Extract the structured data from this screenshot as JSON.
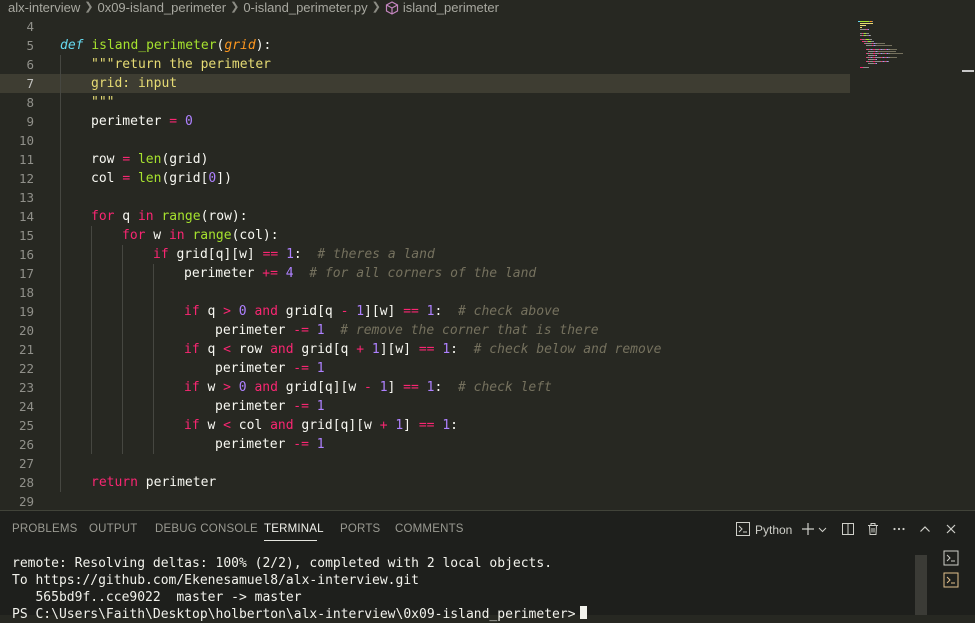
{
  "breadcrumb": {
    "items": [
      "alx-interview",
      "0x09-island_perimeter",
      "0-island_perimeter.py",
      "island_perimeter"
    ],
    "separator": ">"
  },
  "editor": {
    "active_line": 7,
    "lines": [
      {
        "n": "4",
        "indent": 0,
        "t": []
      },
      {
        "n": "5",
        "indent": 0,
        "t": [
          [
            "d",
            "def "
          ],
          [
            "f",
            "island_perimeter"
          ],
          [
            "w",
            "("
          ],
          [
            "p",
            "grid"
          ],
          [
            "w",
            "):"
          ]
        ]
      },
      {
        "n": "6",
        "indent": 1,
        "t": [
          [
            "s",
            "\"\"\"return the perimeter"
          ]
        ]
      },
      {
        "n": "7",
        "indent": 1,
        "t": [
          [
            "s",
            "grid: input"
          ]
        ]
      },
      {
        "n": "8",
        "indent": 1,
        "t": [
          [
            "s",
            "\"\"\""
          ]
        ]
      },
      {
        "n": "9",
        "indent": 1,
        "t": [
          [
            "w",
            "perimeter "
          ],
          [
            "k",
            "="
          ],
          [
            "w",
            " "
          ],
          [
            "n",
            "0"
          ]
        ]
      },
      {
        "n": "10",
        "indent": 0,
        "t": []
      },
      {
        "n": "11",
        "indent": 1,
        "t": [
          [
            "w",
            "row "
          ],
          [
            "k",
            "="
          ],
          [
            "w",
            " "
          ],
          [
            "f",
            "len"
          ],
          [
            "w",
            "(grid)"
          ]
        ]
      },
      {
        "n": "12",
        "indent": 1,
        "t": [
          [
            "w",
            "col "
          ],
          [
            "k",
            "="
          ],
          [
            "w",
            " "
          ],
          [
            "f",
            "len"
          ],
          [
            "w",
            "(grid["
          ],
          [
            "n",
            "0"
          ],
          [
            "w",
            "])"
          ]
        ]
      },
      {
        "n": "13",
        "indent": 0,
        "t": []
      },
      {
        "n": "14",
        "indent": 1,
        "t": [
          [
            "k",
            "for"
          ],
          [
            "w",
            " q "
          ],
          [
            "k",
            "in"
          ],
          [
            "w",
            " "
          ],
          [
            "f",
            "range"
          ],
          [
            "w",
            "(row):"
          ]
        ]
      },
      {
        "n": "15",
        "indent": 2,
        "t": [
          [
            "k",
            "for"
          ],
          [
            "w",
            " w "
          ],
          [
            "k",
            "in"
          ],
          [
            "w",
            " "
          ],
          [
            "f",
            "range"
          ],
          [
            "w",
            "(col):"
          ]
        ]
      },
      {
        "n": "16",
        "indent": 3,
        "t": [
          [
            "k",
            "if"
          ],
          [
            "w",
            " grid[q][w] "
          ],
          [
            "k",
            "=="
          ],
          [
            "w",
            " "
          ],
          [
            "n",
            "1"
          ],
          [
            "w",
            ":  "
          ],
          [
            "c",
            "# theres a land"
          ]
        ]
      },
      {
        "n": "17",
        "indent": 4,
        "t": [
          [
            "w",
            "perimeter "
          ],
          [
            "k",
            "+="
          ],
          [
            "w",
            " "
          ],
          [
            "n",
            "4"
          ],
          [
            "w",
            "  "
          ],
          [
            "c",
            "# for all corners of the land"
          ]
        ]
      },
      {
        "n": "18",
        "indent": 0,
        "t": []
      },
      {
        "n": "19",
        "indent": 4,
        "t": [
          [
            "k",
            "if"
          ],
          [
            "w",
            " q "
          ],
          [
            "k",
            ">"
          ],
          [
            "w",
            " "
          ],
          [
            "n",
            "0"
          ],
          [
            "w",
            " "
          ],
          [
            "k",
            "and"
          ],
          [
            "w",
            " grid[q "
          ],
          [
            "k",
            "-"
          ],
          [
            "w",
            " "
          ],
          [
            "n",
            "1"
          ],
          [
            "w",
            "][w] "
          ],
          [
            "k",
            "=="
          ],
          [
            "w",
            " "
          ],
          [
            "n",
            "1"
          ],
          [
            "w",
            ":  "
          ],
          [
            "c",
            "# check above"
          ]
        ]
      },
      {
        "n": "20",
        "indent": 5,
        "t": [
          [
            "w",
            "perimeter "
          ],
          [
            "k",
            "-="
          ],
          [
            "w",
            " "
          ],
          [
            "n",
            "1"
          ],
          [
            "w",
            "  "
          ],
          [
            "c",
            "# remove the corner that is there"
          ]
        ]
      },
      {
        "n": "21",
        "indent": 4,
        "t": [
          [
            "k",
            "if"
          ],
          [
            "w",
            " q "
          ],
          [
            "k",
            "<"
          ],
          [
            "w",
            " row "
          ],
          [
            "k",
            "and"
          ],
          [
            "w",
            " grid[q "
          ],
          [
            "k",
            "+"
          ],
          [
            "w",
            " "
          ],
          [
            "n",
            "1"
          ],
          [
            "w",
            "][w] "
          ],
          [
            "k",
            "=="
          ],
          [
            "w",
            " "
          ],
          [
            "n",
            "1"
          ],
          [
            "w",
            ":  "
          ],
          [
            "c",
            "# check below and remove"
          ]
        ]
      },
      {
        "n": "22",
        "indent": 5,
        "t": [
          [
            "w",
            "perimeter "
          ],
          [
            "k",
            "-="
          ],
          [
            "w",
            " "
          ],
          [
            "n",
            "1"
          ]
        ]
      },
      {
        "n": "23",
        "indent": 4,
        "t": [
          [
            "k",
            "if"
          ],
          [
            "w",
            " w "
          ],
          [
            "k",
            ">"
          ],
          [
            "w",
            " "
          ],
          [
            "n",
            "0"
          ],
          [
            "w",
            " "
          ],
          [
            "k",
            "and"
          ],
          [
            "w",
            " grid[q][w "
          ],
          [
            "k",
            "-"
          ],
          [
            "w",
            " "
          ],
          [
            "n",
            "1"
          ],
          [
            "w",
            "] "
          ],
          [
            "k",
            "=="
          ],
          [
            "w",
            " "
          ],
          [
            "n",
            "1"
          ],
          [
            "w",
            ":  "
          ],
          [
            "c",
            "# check left"
          ]
        ]
      },
      {
        "n": "24",
        "indent": 5,
        "t": [
          [
            "w",
            "perimeter "
          ],
          [
            "k",
            "-="
          ],
          [
            "w",
            " "
          ],
          [
            "n",
            "1"
          ]
        ]
      },
      {
        "n": "25",
        "indent": 4,
        "t": [
          [
            "k",
            "if"
          ],
          [
            "w",
            " w "
          ],
          [
            "k",
            "<"
          ],
          [
            "w",
            " col "
          ],
          [
            "k",
            "and"
          ],
          [
            "w",
            " grid[q][w "
          ],
          [
            "k",
            "+"
          ],
          [
            "w",
            " "
          ],
          [
            "n",
            "1"
          ],
          [
            "w",
            "] "
          ],
          [
            "k",
            "=="
          ],
          [
            "w",
            " "
          ],
          [
            "n",
            "1"
          ],
          [
            "w",
            ":"
          ]
        ]
      },
      {
        "n": "26",
        "indent": 5,
        "t": [
          [
            "w",
            "perimeter "
          ],
          [
            "k",
            "-="
          ],
          [
            "w",
            " "
          ],
          [
            "n",
            "1"
          ]
        ]
      },
      {
        "n": "27",
        "indent": 0,
        "t": []
      },
      {
        "n": "28",
        "indent": 1,
        "t": [
          [
            "k",
            "return"
          ],
          [
            "w",
            " perimeter"
          ]
        ]
      },
      {
        "n": "29",
        "indent": 0,
        "t": []
      }
    ]
  },
  "panel": {
    "tabs": [
      "PROBLEMS",
      "OUTPUT",
      "DEBUG CONSOLE",
      "TERMINAL",
      "PORTS",
      "COMMENTS"
    ],
    "active_tab": "TERMINAL",
    "terminal_profile": "Python"
  },
  "terminal": {
    "lines": [
      "remote: Resolving deltas: 100% (2/2), completed with 2 local objects.",
      "To https://github.com/Ekenesamuel8/alx-interview.git",
      "   565bd9f..cce9022  master -> master",
      "PS C:\\Users\\Faith\\Desktop\\holberton\\alx-interview\\0x09-island_perimeter>"
    ]
  },
  "colors": {
    "background": "#272822",
    "keyword": "#f92672",
    "function": "#a6e22e",
    "number": "#ae81ff",
    "string": "#e6db74",
    "comment": "#75715e",
    "panel_bg": "#1e1f1c",
    "icon_accent": "#e2c08d"
  },
  "icons": [
    "chevron-right-icon",
    "symbol-method-icon",
    "terminal-icon",
    "plus-icon",
    "chevron-down-icon",
    "split-panel-icon",
    "trash-icon",
    "more-icon",
    "chevron-up-icon",
    "close-icon"
  ]
}
